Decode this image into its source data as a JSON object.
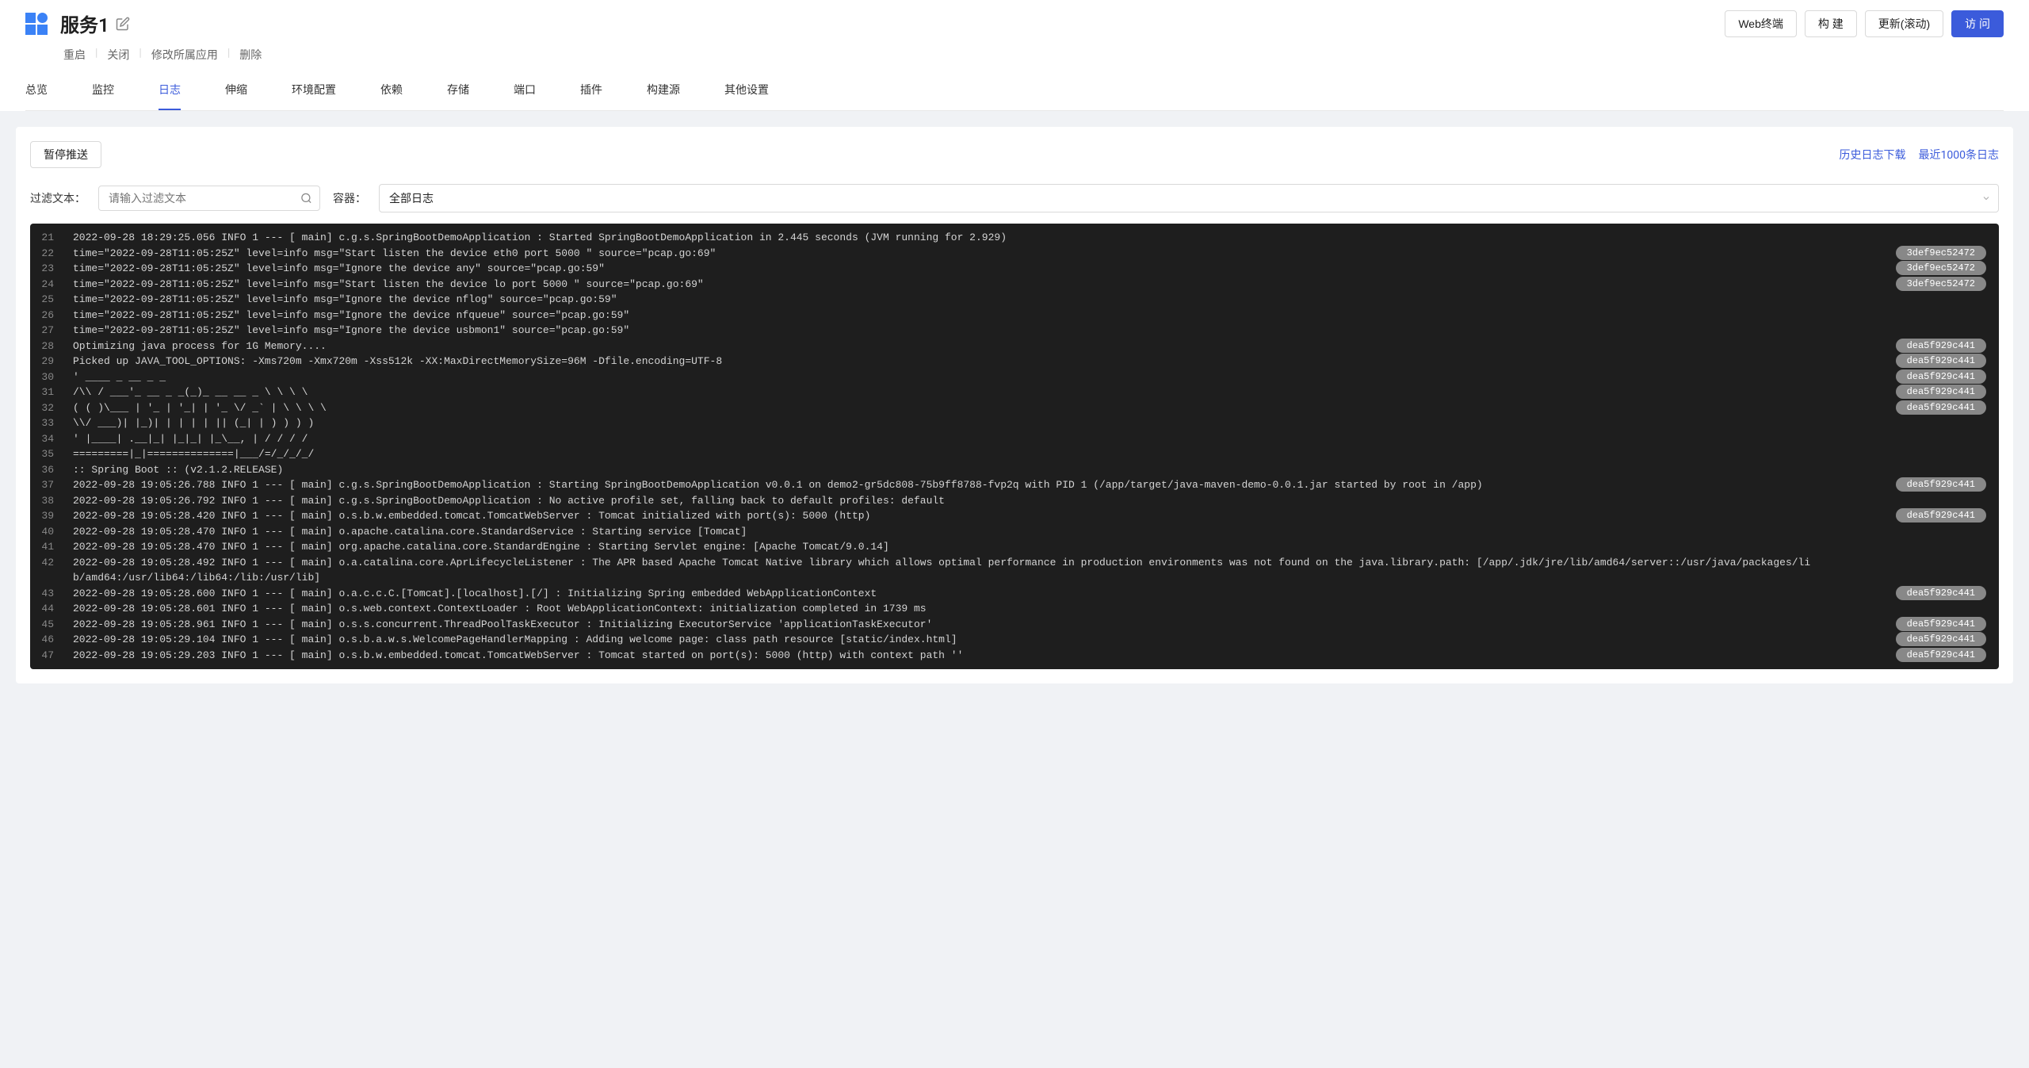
{
  "header": {
    "title": "服务1",
    "buttons": {
      "web_terminal": "Web终端",
      "build": "构 建",
      "update_scroll": "更新(滚动)",
      "visit": "访 问"
    },
    "sub_actions": {
      "restart": "重启",
      "close": "关闭",
      "modify_app": "修改所属应用",
      "delete": "删除"
    }
  },
  "tabs": {
    "overview": "总览",
    "monitoring": "监控",
    "logs": "日志",
    "scaling": "伸缩",
    "env_config": "环境配置",
    "dependency": "依赖",
    "storage": "存储",
    "port": "端口",
    "plugin": "插件",
    "build_source": "构建源",
    "other_settings": "其他设置"
  },
  "log_controls": {
    "pause_push": "暂停推送",
    "history_download": "历史日志下载",
    "recent_1000": "最近1000条日志",
    "filter_label": "过滤文本：",
    "filter_placeholder": "请输入过滤文本",
    "container_label": "容器：",
    "container_selected": "全部日志"
  },
  "log_lines": [
    {
      "n": 21,
      "t": "2022-09-28 18:29:25.056 INFO 1 --- [ main] c.g.s.SpringBootDemoApplication : Started SpringBootDemoApplication in 2.445 seconds (JVM running for 2.929)",
      "tag": ""
    },
    {
      "n": 22,
      "t": "time=\"2022-09-28T11:05:25Z\" level=info msg=\"Start listen the device eth0 port 5000 \" source=\"pcap.go:69\"",
      "tag": "3def9ec52472"
    },
    {
      "n": 23,
      "t": "time=\"2022-09-28T11:05:25Z\" level=info msg=\"Ignore the device any\" source=\"pcap.go:59\"",
      "tag": "3def9ec52472"
    },
    {
      "n": 24,
      "t": "time=\"2022-09-28T11:05:25Z\" level=info msg=\"Start listen the device lo port 5000 \" source=\"pcap.go:69\"",
      "tag": "3def9ec52472"
    },
    {
      "n": 25,
      "t": "time=\"2022-09-28T11:05:25Z\" level=info msg=\"Ignore the device nflog\" source=\"pcap.go:59\"",
      "tag": ""
    },
    {
      "n": 26,
      "t": "time=\"2022-09-28T11:05:25Z\" level=info msg=\"Ignore the device nfqueue\" source=\"pcap.go:59\"",
      "tag": ""
    },
    {
      "n": 27,
      "t": "time=\"2022-09-28T11:05:25Z\" level=info msg=\"Ignore the device usbmon1\" source=\"pcap.go:59\"",
      "tag": ""
    },
    {
      "n": 28,
      "t": "Optimizing java process for 1G Memory....",
      "tag": "dea5f929c441"
    },
    {
      "n": 29,
      "t": "Picked up JAVA_TOOL_OPTIONS: -Xms720m -Xmx720m -Xss512k -XX:MaxDirectMemorySize=96M -Dfile.encoding=UTF-8",
      "tag": "dea5f929c441"
    },
    {
      "n": 30,
      "t": "' ____ _ __ _ _",
      "tag": "dea5f929c441"
    },
    {
      "n": 31,
      "t": "/\\\\ / ___'_ __ _ _(_)_ __ __ _ \\ \\ \\ \\",
      "tag": "dea5f929c441"
    },
    {
      "n": 32,
      "t": "( ( )\\___ | '_ | '_| | '_ \\/ _` | \\ \\ \\ \\",
      "tag": "dea5f929c441"
    },
    {
      "n": 33,
      "t": "\\\\/ ___)| |_)| | | | | || (_| | ) ) ) )",
      "tag": ""
    },
    {
      "n": 34,
      "t": "' |____| .__|_| |_|_| |_\\__, | / / / /",
      "tag": ""
    },
    {
      "n": 35,
      "t": "=========|_|==============|___/=/_/_/_/",
      "tag": ""
    },
    {
      "n": 36,
      "t": ":: Spring Boot :: (v2.1.2.RELEASE)",
      "tag": ""
    },
    {
      "n": 37,
      "t": "2022-09-28 19:05:26.788 INFO 1 --- [ main] c.g.s.SpringBootDemoApplication : Starting SpringBootDemoApplication v0.0.1 on demo2-gr5dc808-75b9ff8788-fvp2q with PID 1 (/app/target/java-maven-demo-0.0.1.jar started by root in /app)",
      "tag": "dea5f929c441"
    },
    {
      "n": 38,
      "t": "2022-09-28 19:05:26.792 INFO 1 --- [ main] c.g.s.SpringBootDemoApplication : No active profile set, falling back to default profiles: default",
      "tag": ""
    },
    {
      "n": 39,
      "t": "2022-09-28 19:05:28.420 INFO 1 --- [ main] o.s.b.w.embedded.tomcat.TomcatWebServer : Tomcat initialized with port(s): 5000 (http)",
      "tag": "dea5f929c441"
    },
    {
      "n": 40,
      "t": "2022-09-28 19:05:28.470 INFO 1 --- [ main] o.apache.catalina.core.StandardService : Starting service [Tomcat]",
      "tag": ""
    },
    {
      "n": 41,
      "t": "2022-09-28 19:05:28.470 INFO 1 --- [ main] org.apache.catalina.core.StandardEngine : Starting Servlet engine: [Apache Tomcat/9.0.14]",
      "tag": ""
    },
    {
      "n": 42,
      "t": "2022-09-28 19:05:28.492 INFO 1 --- [ main] o.a.catalina.core.AprLifecycleListener : The APR based Apache Tomcat Native library which allows optimal performance in production environments was not found on the java.library.path: [/app/.jdk/jre/lib/amd64/server::/usr/java/packages/lib/amd64:/usr/lib64:/lib64:/lib:/usr/lib]",
      "tag": ""
    },
    {
      "n": 43,
      "t": "2022-09-28 19:05:28.600 INFO 1 --- [ main] o.a.c.c.C.[Tomcat].[localhost].[/] : Initializing Spring embedded WebApplicationContext",
      "tag": "dea5f929c441"
    },
    {
      "n": 44,
      "t": "2022-09-28 19:05:28.601 INFO 1 --- [ main] o.s.web.context.ContextLoader : Root WebApplicationContext: initialization completed in 1739 ms",
      "tag": ""
    },
    {
      "n": 45,
      "t": "2022-09-28 19:05:28.961 INFO 1 --- [ main] o.s.s.concurrent.ThreadPoolTaskExecutor : Initializing ExecutorService 'applicationTaskExecutor'",
      "tag": "dea5f929c441"
    },
    {
      "n": 46,
      "t": "2022-09-28 19:05:29.104 INFO 1 --- [ main] o.s.b.a.w.s.WelcomePageHandlerMapping : Adding welcome page: class path resource [static/index.html]",
      "tag": "dea5f929c441"
    },
    {
      "n": 47,
      "t": "2022-09-28 19:05:29.203 INFO 1 --- [ main] o.s.b.w.embedded.tomcat.TomcatWebServer : Tomcat started on port(s): 5000 (http) with context path ''",
      "tag": "dea5f929c441"
    }
  ]
}
